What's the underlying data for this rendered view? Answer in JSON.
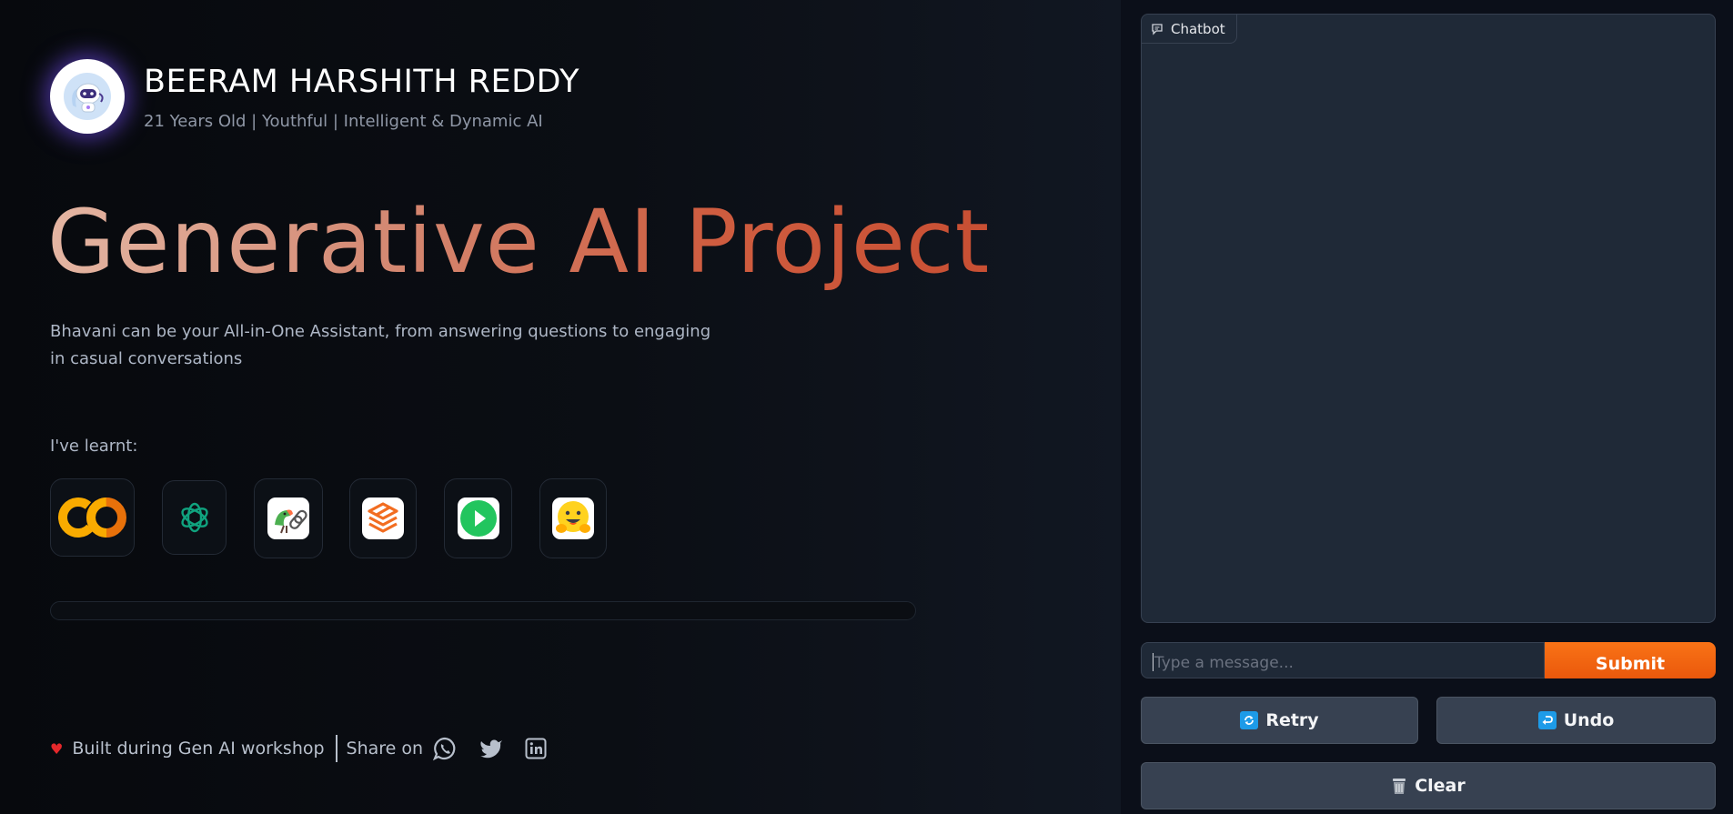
{
  "profile": {
    "name": "BEERAM HARSHITH REDDY",
    "tagline": "21 Years Old | Youthful | Intelligent & Dynamic AI",
    "avatar_icon": "robot-icon"
  },
  "hero": {
    "title": "Generative AI Project",
    "description": "Bhavani can be your All-in-One Assistant, from answering questions to engaging in casual conversations"
  },
  "learnt": {
    "label": "I've learnt:",
    "tools": [
      "google-colab-icon",
      "openai-icon",
      "langchain-icon",
      "layers-stack-icon",
      "play-button-icon",
      "hugging-face-icon"
    ]
  },
  "progress": {
    "value": 0
  },
  "footer": {
    "built_text": "Built during Gen AI workshop",
    "share_label": "Share on",
    "social_icons": [
      "whatsapp-icon",
      "twitter-icon",
      "linkedin-icon"
    ]
  },
  "chatbot": {
    "label": "Chatbot",
    "input_placeholder": "Type a message...",
    "submit_label": "Submit",
    "retry_label": "Retry",
    "undo_label": "Undo",
    "clear_label": "Clear"
  },
  "colors": {
    "accent": "#f97316",
    "title_gradient_start": "#e4b6a3",
    "title_gradient_end": "#c84f33",
    "panel": "#1f2937",
    "button": "#374151"
  }
}
